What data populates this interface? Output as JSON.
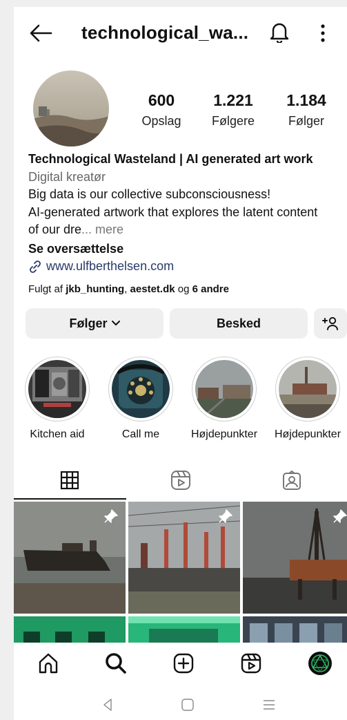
{
  "profile": {
    "username": "technological_wa...",
    "stats": [
      {
        "value": "600",
        "label": "Opslag"
      },
      {
        "value": "1.221",
        "label": "Følgere"
      },
      {
        "value": "1.184",
        "label": "Følger"
      }
    ],
    "display_name": "Technological Wasteland | AI generated art work",
    "category": "Digital kreatør",
    "bio_line1": "Big data is our collective subconsciousness!",
    "bio_line2": "AI-generated artwork that explores the latent content",
    "bio_line3": "of our dre",
    "bio_more": "... mere",
    "see_translation": "Se oversættelse",
    "website": "www.ulfberthelsen.com",
    "followed_prefix": "Fulgt af ",
    "followed_user1": "jkb_hunting",
    "followed_sep": ", ",
    "followed_user2": "aestet.dk",
    "followed_and": " og ",
    "followed_others": "6 andre"
  },
  "actions": {
    "follow_label": "Følger",
    "message_label": "Besked",
    "add_icon": "add-person-icon"
  },
  "highlights": [
    {
      "label": "Kitchen aid"
    },
    {
      "label": "Call me"
    },
    {
      "label": "Højdepunkter"
    },
    {
      "label": "Højdepunkter"
    }
  ],
  "tabs": [
    "grid-icon",
    "reels-icon",
    "tagged-icon"
  ],
  "nav": [
    "home-icon",
    "search-icon",
    "create-icon",
    "reels-icon",
    "profile-avatar"
  ],
  "colors": {
    "accent_link": "#2a3a6a",
    "button_bg": "#efefef",
    "text": "#111111"
  }
}
